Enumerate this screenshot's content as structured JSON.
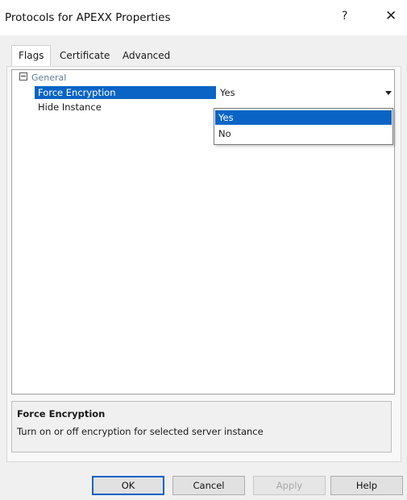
{
  "window": {
    "title": "Protocols for APEXX Properties",
    "help_label": "?",
    "close_label": "✕"
  },
  "tabs": [
    {
      "label": "Flags",
      "active": true
    },
    {
      "label": "Certificate",
      "active": false
    },
    {
      "label": "Advanced",
      "active": false
    }
  ],
  "property_grid": {
    "category": "General",
    "properties": [
      {
        "name": "Force Encryption",
        "value": "Yes",
        "selected": true
      },
      {
        "name": "Hide Instance",
        "value": ""
      }
    ],
    "dropdown": {
      "options": [
        "Yes",
        "No"
      ],
      "selected": "Yes"
    }
  },
  "description": {
    "title": "Force Encryption",
    "text": "Turn on or off encryption for selected server instance"
  },
  "buttons": {
    "ok": "OK",
    "cancel": "Cancel",
    "apply": "Apply",
    "help": "Help"
  },
  "colors": {
    "selection": "#0a64c6",
    "category_text": "#5b7a97"
  },
  "icons": {
    "collapse": "minus-box-icon",
    "dropdown": "chevron-down-icon"
  }
}
